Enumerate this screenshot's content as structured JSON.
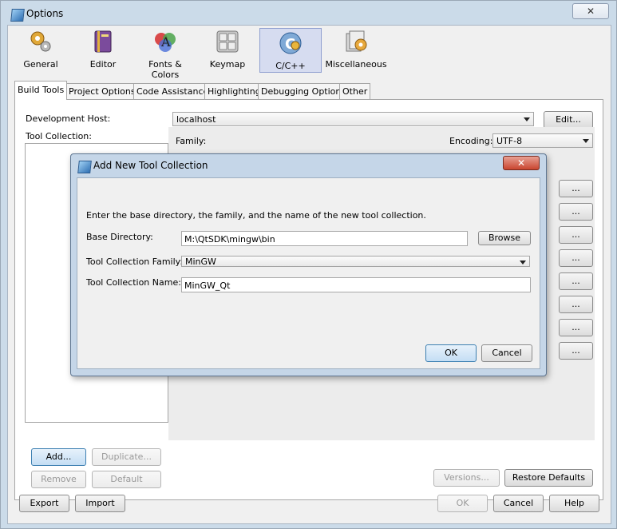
{
  "window": {
    "title": "Options",
    "close_glyph": "✕"
  },
  "categories": [
    {
      "label": "General",
      "icon": "gears-icon"
    },
    {
      "label": "Editor",
      "icon": "book-icon"
    },
    {
      "label": "Fonts & Colors",
      "icon": "palette-icon"
    },
    {
      "label": "Keymap",
      "icon": "keyboard-icon"
    },
    {
      "label": "C/C++",
      "icon": "c-cpp-icon"
    },
    {
      "label": "Miscellaneous",
      "icon": "misc-icon"
    }
  ],
  "tabs": [
    "Build Tools",
    "Project Options",
    "Code Assistance",
    "Highlighting",
    "Debugging Options",
    "Other"
  ],
  "build_tools": {
    "dev_host_label": "Development Host:",
    "dev_host_value": "localhost",
    "edit_button": "Edit...",
    "tool_collection_label": "Tool Collection:",
    "family_label": "Family:",
    "encoding_label": "Encoding:",
    "encoding_value": "UTF-8",
    "ellipsis": "...",
    "add_button": "Add...",
    "duplicate_button": "Duplicate...",
    "remove_button": "Remove",
    "default_button": "Default",
    "versions_button": "Versions...",
    "restore_button": "Restore Defaults"
  },
  "footer": {
    "export": "Export",
    "import": "Import",
    "ok": "OK",
    "cancel": "Cancel",
    "help": "Help"
  },
  "dialog": {
    "title": "Add New Tool Collection",
    "close_glyph": "✕",
    "instructions": "Enter the base directory, the family, and the name of the new tool collection.",
    "base_dir_label": "Base Directory:",
    "base_dir_value": "M:\\QtSDK\\mingw\\bin",
    "browse_button": "Browse",
    "family_label": "Tool Collection Family:",
    "family_value": "MinGW",
    "name_label": "Tool Collection Name:",
    "name_value": "MinGW_Qt",
    "ok": "OK",
    "cancel": "Cancel"
  }
}
